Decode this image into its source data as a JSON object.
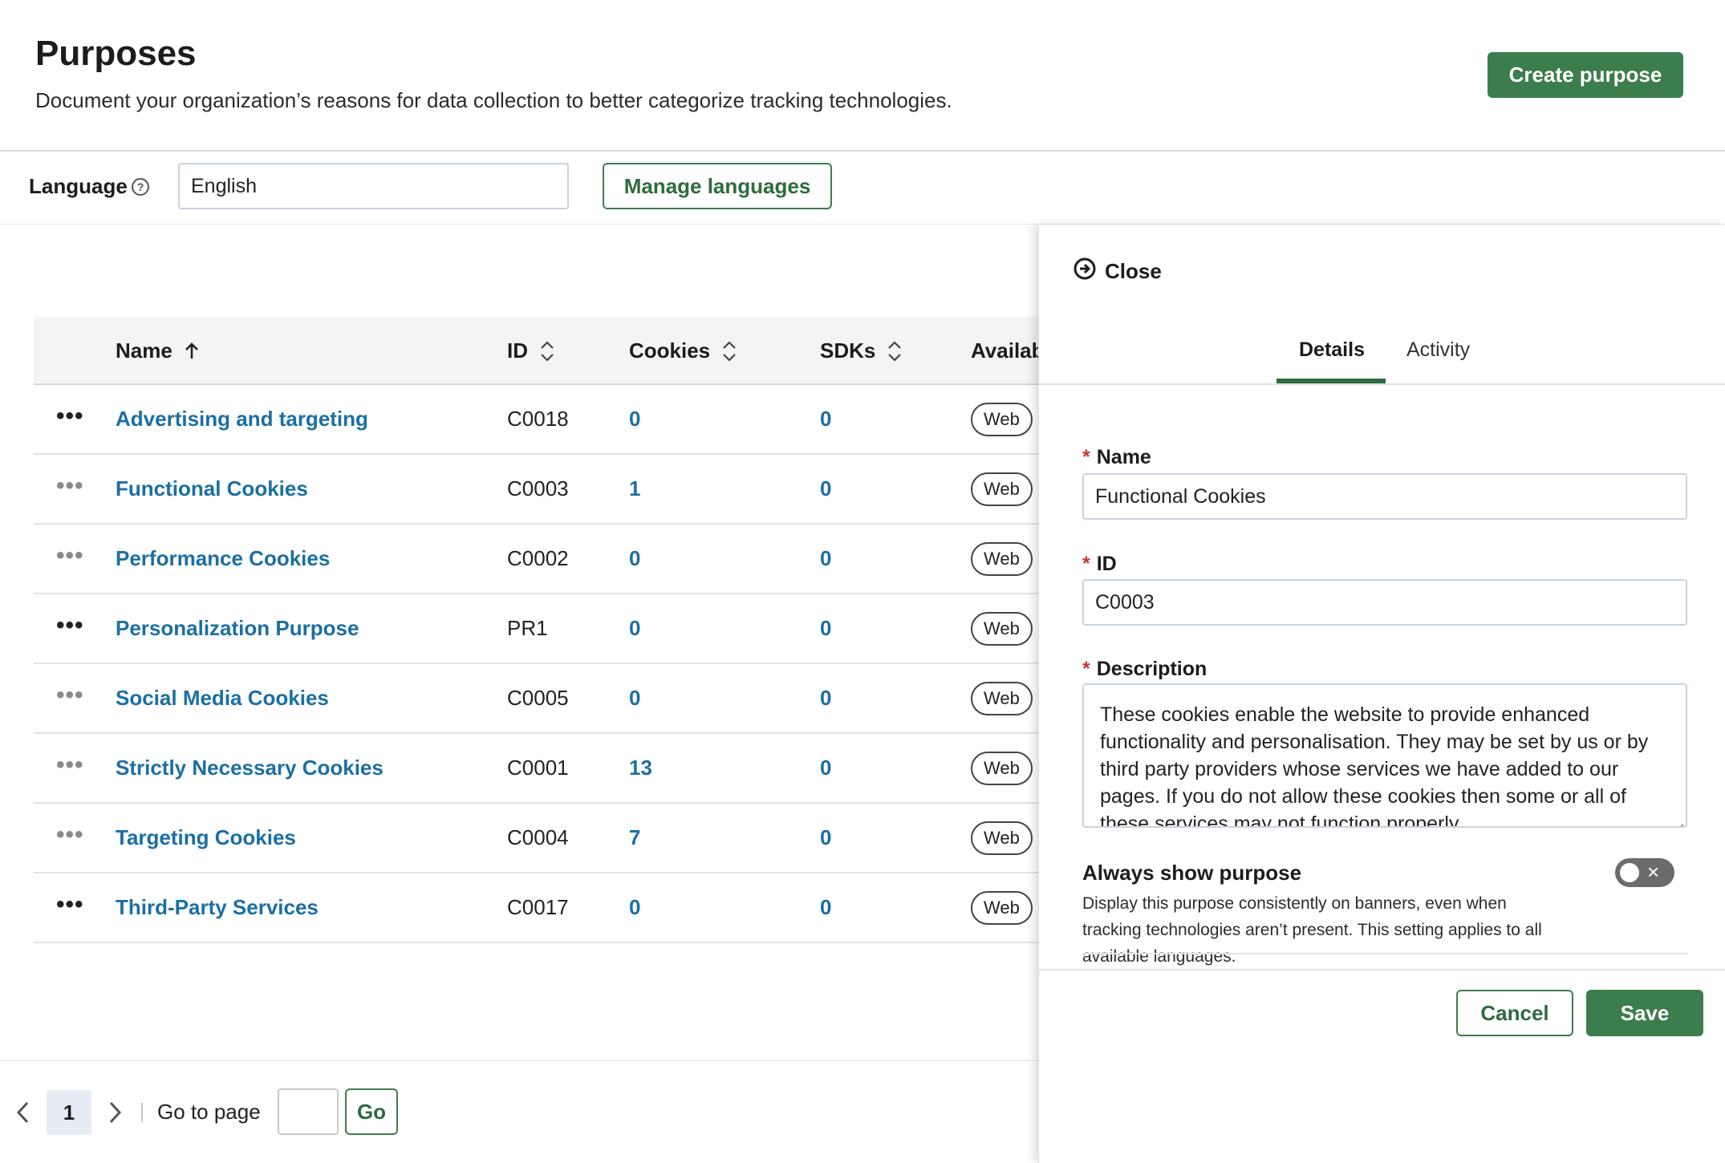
{
  "header": {
    "title": "Purposes",
    "subtitle": "Document your organization’s reasons for data collection to better categorize tracking technologies.",
    "create_button": "Create purpose"
  },
  "language_bar": {
    "label": "Language",
    "help_icon": "help-circle-icon",
    "selected": "English",
    "manage_button": "Manage languages"
  },
  "table": {
    "columns": [
      "Name",
      "ID",
      "Cookies",
      "SDKs",
      "Availab"
    ],
    "sort": {
      "column": "Name",
      "direction": "ascending"
    },
    "rows": [
      {
        "name": "Advertising and targeting",
        "id": "C0018",
        "cookies": "0",
        "sdks": "0",
        "availability": "Web"
      },
      {
        "name": "Functional Cookies",
        "id": "C0003",
        "cookies": "1",
        "sdks": "0",
        "availability": "Web"
      },
      {
        "name": "Performance Cookies",
        "id": "C0002",
        "cookies": "0",
        "sdks": "0",
        "availability": "Web"
      },
      {
        "name": "Personalization Purpose",
        "id": "PR1",
        "cookies": "0",
        "sdks": "0",
        "availability": "Web"
      },
      {
        "name": "Social Media Cookies",
        "id": "C0005",
        "cookies": "0",
        "sdks": "0",
        "availability": "Web"
      },
      {
        "name": "Strictly Necessary Cookies",
        "id": "C0001",
        "cookies": "13",
        "sdks": "0",
        "availability": "Web"
      },
      {
        "name": "Targeting Cookies",
        "id": "C0004",
        "cookies": "7",
        "sdks": "0",
        "availability": "Web"
      },
      {
        "name": "Third-Party Services",
        "id": "C0017",
        "cookies": "0",
        "sdks": "0",
        "availability": "Web"
      }
    ],
    "row_menu_glyph": "•••"
  },
  "pagination": {
    "current_page": "1",
    "goto_label": "Go to page",
    "go_button": "Go"
  },
  "panel": {
    "close_label": "Close",
    "tabs": [
      "Details",
      "Activity"
    ],
    "active_tab": "Details",
    "required_mark": "*",
    "name_label": "Name",
    "name_value": "Functional Cookies",
    "id_label": "ID",
    "id_value": "C0003",
    "description_label": "Description",
    "description_value": "These cookies enable the website to provide enhanced functionality and personalisation. They may be set by us or by third party providers whose services we have added to our pages. If you do not allow these cookies then some or all of these services may not function properly.",
    "toggle_title": "Always show purpose",
    "toggle_description": "Display this purpose consistently on banners, even when tracking technologies aren’t present. This setting applies to all available languages.",
    "toggle_state": "off",
    "cancel_button": "Cancel",
    "save_button": "Save"
  },
  "colors": {
    "brand_green": "#3c7d4c",
    "link_blue": "#1b6fa3",
    "required_red": "#c23934"
  }
}
